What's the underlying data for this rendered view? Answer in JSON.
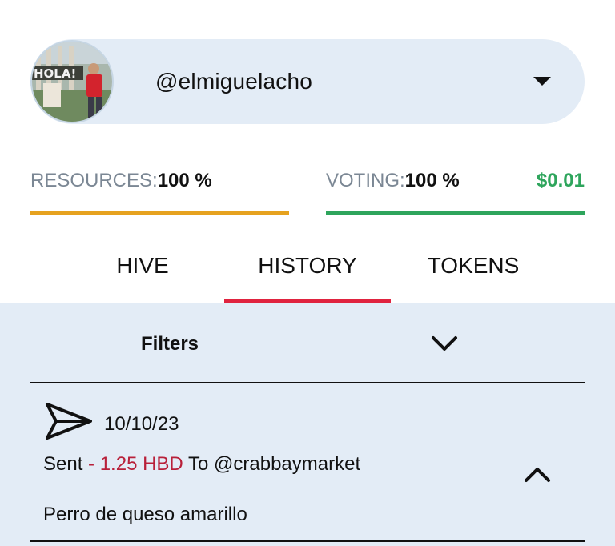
{
  "account": {
    "username": "@elmiguelacho",
    "avatar_text": "HOLA!"
  },
  "resources": {
    "label": "RESOURCES:",
    "value": "100 %",
    "level": 1.0,
    "bar_color": "#e6a21f"
  },
  "voting": {
    "label": "VOTING:",
    "value": "100 %",
    "level": 1.0,
    "bar_color": "#2ea55c",
    "vote_value": "$0.01"
  },
  "tabs": [
    {
      "label": "HIVE",
      "active": false
    },
    {
      "label": "HISTORY",
      "active": true
    },
    {
      "label": "TOKENS",
      "active": false
    }
  ],
  "accent_color": "#e0233f",
  "history": {
    "filters_label": "Filters",
    "transaction": {
      "date": "10/10/23",
      "type": "Sent",
      "amount": "- 1.25 HBD",
      "to_label": "To",
      "recipient": "@crabbaymarket",
      "memo": "Perro de queso amarillo"
    }
  }
}
